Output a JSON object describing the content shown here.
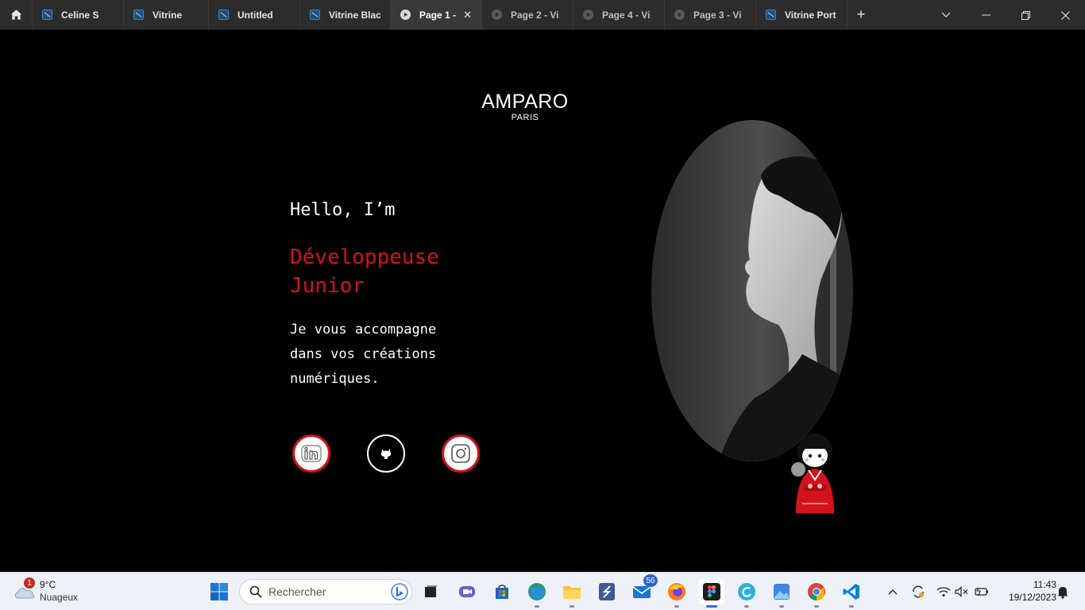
{
  "tabs": [
    {
      "label": "Celine S",
      "type": "design",
      "active": false
    },
    {
      "label": "Vitrine",
      "type": "design",
      "active": false
    },
    {
      "label": "Untitled",
      "type": "design",
      "active": false
    },
    {
      "label": "Vitrine Blac",
      "type": "design",
      "active": false
    },
    {
      "label": "Page 1 -",
      "type": "prototype",
      "active": true
    },
    {
      "label": "Page 2 - Vi",
      "type": "prototype",
      "active": false
    },
    {
      "label": "Page 4 - Vi",
      "type": "prototype",
      "active": false
    },
    {
      "label": "Page 3 - Vi",
      "type": "prototype",
      "active": false
    },
    {
      "label": "Vitrine Port",
      "type": "design",
      "active": false
    }
  ],
  "window_controls": {
    "tab_list": "chevron-down",
    "minimize": "minimize",
    "restore": "restore",
    "close": "close"
  },
  "page": {
    "brand": {
      "name": "AMPARO",
      "city": "PARIS"
    },
    "greeting": "Hello, I’m",
    "role_line1": "Développeuse",
    "role_line2": "Junior",
    "pitch_line1": "Je vous accompagne",
    "pitch_line2": "dans vos créations",
    "pitch_line3": "numériques.",
    "social_links": [
      "linkedin-icon",
      "github-icon",
      "instagram-icon"
    ],
    "accent_color": "#d5121b"
  },
  "taskbar": {
    "weather": {
      "temperature": "9°C",
      "condition": "Nuageux",
      "badge": "1"
    },
    "search": {
      "placeholder": "Rechercher"
    },
    "mail_badge": "56",
    "apps": [
      "start",
      "search",
      "task-view",
      "teams",
      "store",
      "edge",
      "explorer",
      "app-s",
      "mail",
      "firefox",
      "figma",
      "canva",
      "photos",
      "chrome",
      "vscode"
    ],
    "time": "11:43",
    "date": "19/12/2023"
  }
}
